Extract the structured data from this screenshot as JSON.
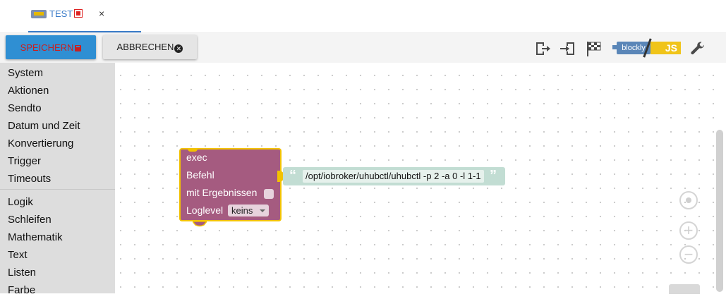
{
  "tabs": [
    {
      "label": "TEST",
      "close": "×"
    }
  ],
  "toolbar": {
    "save_label": "SPEICHERN",
    "cancel_label": "ABBRECHEN",
    "blockly_label": "blockly",
    "js_label": "JS"
  },
  "sidebar": {
    "groups": [
      [
        "System",
        "Aktionen",
        "Sendto",
        "Datum und Zeit",
        "Konvertierung",
        "Trigger",
        "Timeouts"
      ],
      [
        "Logik",
        "Schleifen",
        "Mathematik",
        "Text",
        "Listen",
        "Farbe"
      ]
    ]
  },
  "block": {
    "title": "exec",
    "command_label": "Befehl",
    "results_label": "mit Ergebnissen",
    "loglevel_label": "Loglevel",
    "loglevel_value": "keins",
    "command_value": "/opt/iobroker/uhubctl/uhubctl -p 2 -a 0 -l 1-1"
  },
  "colors": {
    "accent": "#3a7bc8",
    "save_button": "#2f8fd3",
    "block": "#a55b80",
    "block_selected_border": "#f2c200",
    "string_block": "#c2ddd3"
  }
}
